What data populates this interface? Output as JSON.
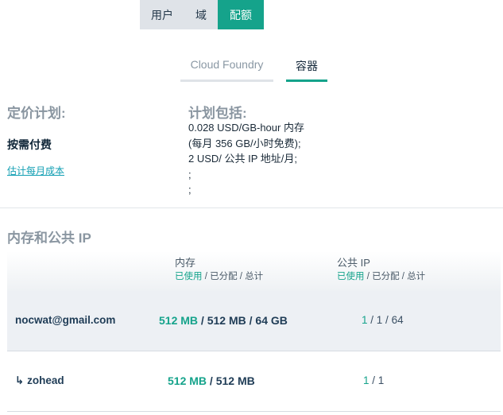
{
  "top_tabs": [
    {
      "label": "用户",
      "active": false
    },
    {
      "label": "域",
      "active": false
    },
    {
      "label": "配额",
      "active": true
    }
  ],
  "sub_tabs": [
    {
      "label": "Cloud Foundry",
      "active": false
    },
    {
      "label": "容器",
      "active": true
    }
  ],
  "pricing": {
    "heading": "定价计划:",
    "plan": "按需付费",
    "estimate_link": "估计每月成本"
  },
  "includes": {
    "heading": "计划包括:",
    "lines": [
      "0.028 USD/GB-hour 内存",
      "(每月 356 GB/小时免费);",
      "2 USD/ 公共 IP 地址/月;",
      ";",
      ";"
    ]
  },
  "usage": {
    "title": "内存和公共 IP",
    "columns": [
      {
        "title": "内存",
        "used": "已使用",
        "sep1": " / ",
        "allocated": "已分配",
        "sep2": " / ",
        "total": "总计"
      },
      {
        "title": "公共 IP",
        "used": "已使用",
        "sep1": " / ",
        "allocated": "已分配",
        "sep2": " / ",
        "total": "总计"
      }
    ],
    "rows": [
      {
        "name": "nocwat@gmail.com",
        "arrow": "",
        "mem_used": "512 MB",
        "mem_sep1": " / ",
        "mem_alloc": "512 MB",
        "mem_sep2": " / ",
        "mem_total": "64 GB",
        "ip_used": "1",
        "ip_sep1": " / ",
        "ip_alloc": "1",
        "ip_sep2": " / ",
        "ip_total": "64"
      },
      {
        "name": "zohead",
        "arrow": "↳",
        "mem_used": "512 MB",
        "mem_sep1": " / ",
        "mem_alloc": "512 MB",
        "ip_used": "1",
        "ip_sep1": " / ",
        "ip_alloc": "1"
      }
    ]
  },
  "colors": {
    "accent": "#15a38b",
    "link": "#129fb3",
    "heading_gray": "#8995a0",
    "tab_bg": "#dfe3e8",
    "row_highlight": "#edf0f4"
  }
}
